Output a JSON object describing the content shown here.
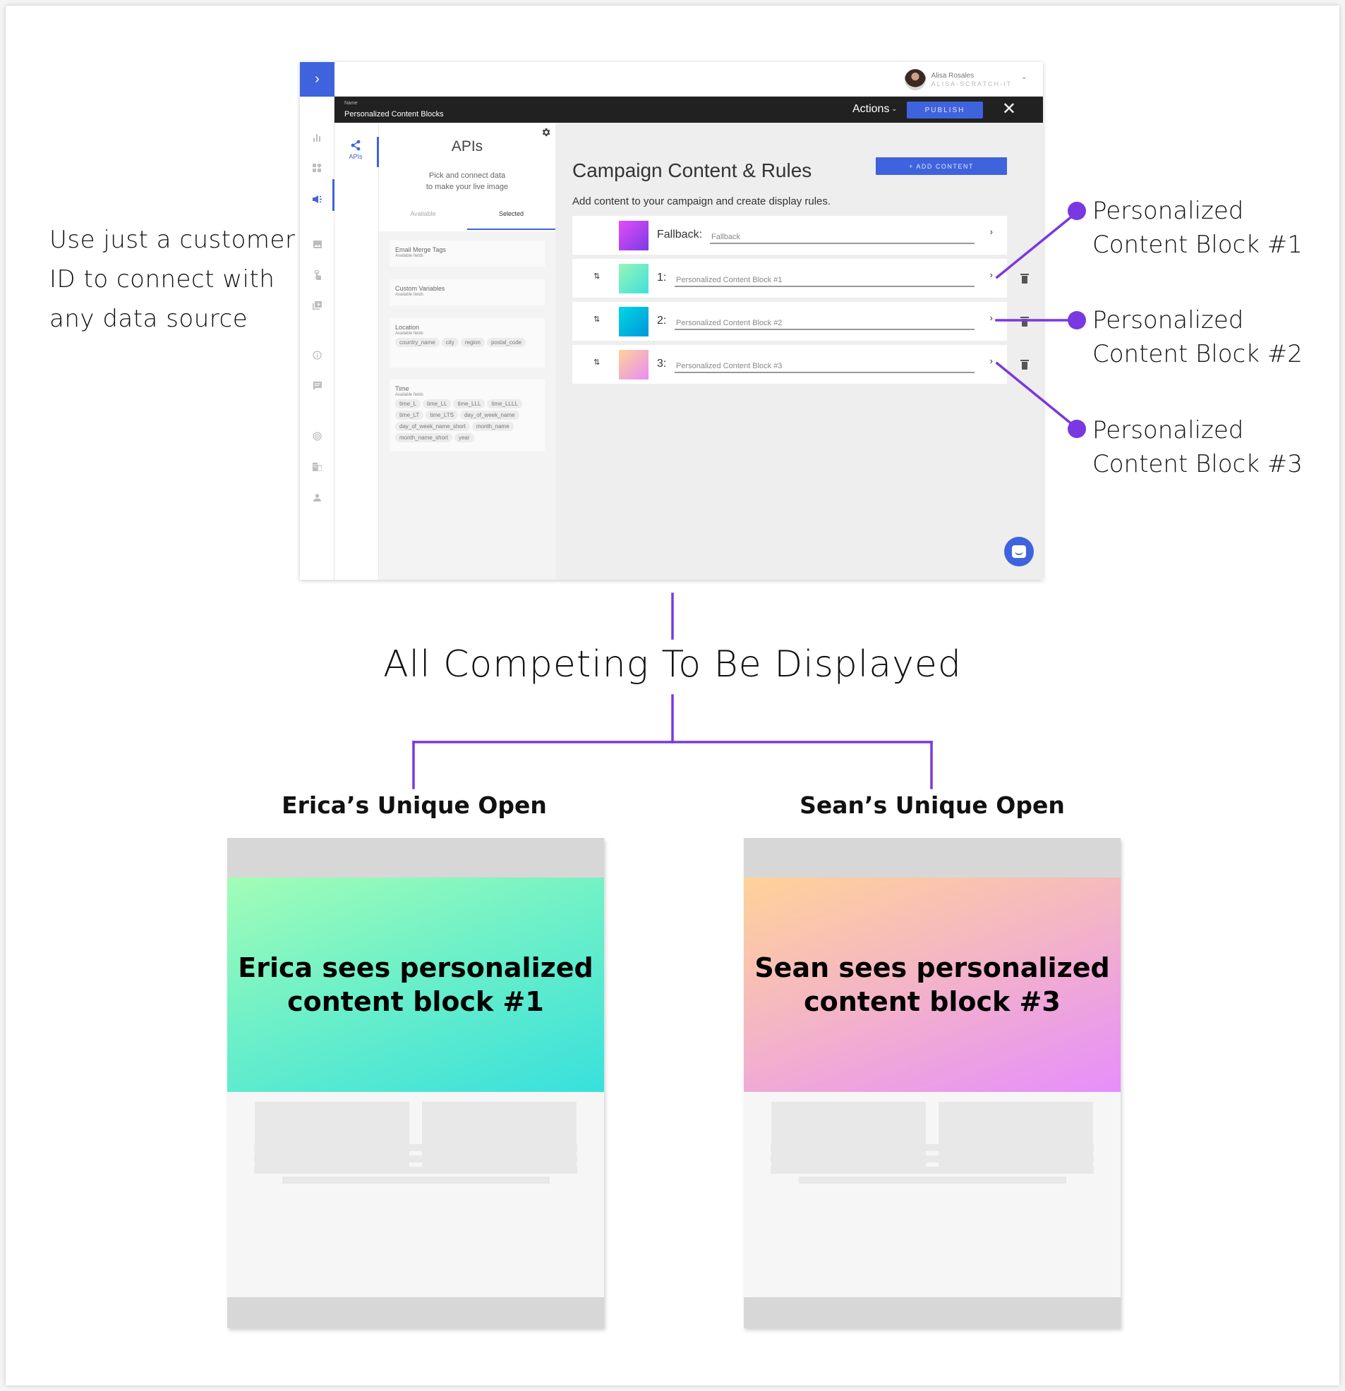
{
  "caption": {
    "lines": [
      "Use just a customer",
      "ID to connect with",
      "any data source"
    ]
  },
  "app": {
    "sidebar_toggle_icon": "chevron-right-icon",
    "sidebar_toggle_glyph": "›",
    "user": {
      "name": "Alisa Rosales",
      "org": "ALISA-SCRATCH-IT",
      "caret": "⌄"
    },
    "namebar": {
      "label": "Name",
      "value": "Personalized Content Blocks",
      "actions_label": "Actions",
      "actions_caret": "⌄",
      "publish_label": "PUBLISH",
      "close_glyph": "✕"
    },
    "rail_icons": [
      {
        "name": "analytics-icon",
        "glyph": "▮"
      },
      {
        "name": "widgets-icon",
        "glyph": "▦"
      },
      {
        "name": "campaign-megaphone-icon",
        "glyph": "◀"
      },
      {
        "name": "image-icon",
        "glyph": "▣"
      },
      {
        "name": "touch-icon",
        "glyph": "☝"
      },
      {
        "name": "video-library-icon",
        "glyph": "▶"
      },
      {
        "name": "info-icon",
        "glyph": "ⓘ"
      },
      {
        "name": "chat-message-icon",
        "glyph": "▤"
      },
      {
        "name": "target-icon",
        "glyph": "◎"
      },
      {
        "name": "business-icon",
        "glyph": "▥"
      },
      {
        "name": "person-icon",
        "glyph": "●"
      }
    ],
    "subrail": {
      "api_glyph": "<",
      "api_label": "APIs"
    },
    "panel": {
      "title": "APIs",
      "subtitle_lines": [
        "Pick and connect data",
        "to make your live image"
      ],
      "tabs": [
        "Available",
        "Selected"
      ],
      "selected_tab": "Selected",
      "field_groups": [
        {
          "title": "Email Merge Tags",
          "subtitle": "Available fields",
          "chips": []
        },
        {
          "title": "Custom Variables",
          "subtitle": "Available fields",
          "chips": []
        },
        {
          "title": "Location",
          "subtitle": "Available fields",
          "chips": [
            "country_name",
            "city",
            "region",
            "postal_code"
          ]
        },
        {
          "title": "Time",
          "subtitle": "Available fields",
          "chips": [
            "time_L",
            "time_LL",
            "time_LLL",
            "time_LLLL",
            "time_LT",
            "time_LTS",
            "day_of_week_name",
            "day_of_week_name_short",
            "month_name",
            "month_name_short",
            "year"
          ]
        }
      ]
    },
    "content": {
      "title": "Campaign Content & Rules",
      "add_button": "+ ADD CONTENT",
      "subtitle": "Add content to your campaign and create display rules.",
      "rows": [
        {
          "label": "Fallback:",
          "value": "Fallback",
          "sortable": false,
          "deletable": false,
          "swatch": [
            "#e24df7",
            "#7b3ae8"
          ]
        },
        {
          "label": "1:",
          "value": "Personalized Content Block #1",
          "sortable": true,
          "deletable": true,
          "swatch": [
            "#96f5b7",
            "#3fe0dc"
          ]
        },
        {
          "label": "2:",
          "value": "Personalized Content Block #2",
          "sortable": true,
          "deletable": true,
          "swatch": [
            "#00d7e2",
            "#0096dc"
          ]
        },
        {
          "label": "3:",
          "value": "Personalized Content Block #3",
          "sortable": true,
          "deletable": true,
          "swatch": [
            "#ffd296",
            "#e88cf5"
          ]
        }
      ],
      "sort_glyph": "⇅",
      "chevron_glyph": "›"
    }
  },
  "annotations": [
    {
      "lines": [
        "Personalized",
        "Content Block #1"
      ]
    },
    {
      "lines": [
        "Personalized",
        "Content Block #2"
      ]
    },
    {
      "lines": [
        "Personalized",
        "Content Block #3"
      ]
    }
  ],
  "competing_title": "All Competing To Be Displayed",
  "opens": [
    {
      "label": "Erica’s Unique Open",
      "hero_lines": [
        "Erica sees personalized",
        "content block #1"
      ],
      "gradient": [
        "#a2fdb6",
        "#38e0dc"
      ]
    },
    {
      "label": "Sean’s Unique Open",
      "hero_lines": [
        "Sean sees personalized",
        "content block #3"
      ],
      "gradient": [
        "#ffd298",
        "#e68efc"
      ]
    }
  ],
  "colors": {
    "accent_blue": "#3f63dd",
    "connector_purple": "#7a38e0",
    "namebar_black": "#212121"
  }
}
